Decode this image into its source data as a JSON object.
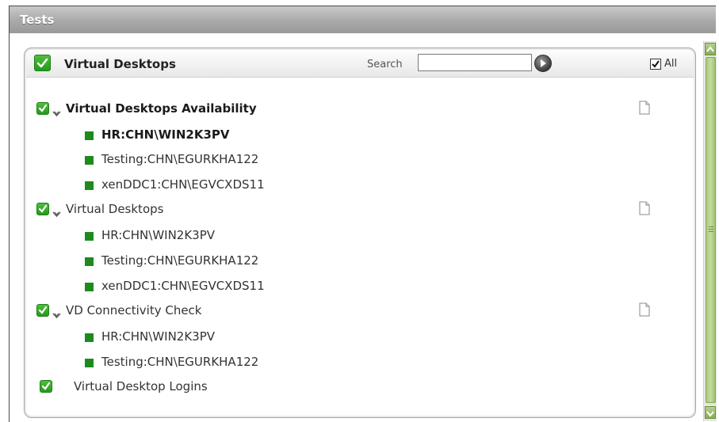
{
  "tests_section": {
    "title": "Tests"
  },
  "panel": {
    "title": "Virtual Desktops",
    "search_label": "Search",
    "search_value": "",
    "all_label": "All",
    "all_checked": true
  },
  "tests": [
    {
      "name": "Virtual Desktops Availability",
      "selected": true,
      "items": [
        "HR:CHN\\WIN2K3PV",
        "Testing:CHN\\EGURKHA122",
        "xenDDC1:CHN\\EGVCXDS11"
      ]
    },
    {
      "name": "Virtual Desktops",
      "selected": false,
      "items": [
        "HR:CHN\\WIN2K3PV",
        "Testing:CHN\\EGURKHA122",
        "xenDDC1:CHN\\EGVCXDS11"
      ]
    },
    {
      "name": "VD Connectivity Check",
      "selected": false,
      "items": [
        "HR:CHN\\WIN2K3PV",
        "Testing:CHN\\EGURKHA122"
      ]
    },
    {
      "name": "Virtual Desktop Logins",
      "selected": false,
      "items": []
    }
  ],
  "colors": {
    "check_green": "#2aa022",
    "leaf_green": "#1e8a1e",
    "header_gray": "#a9a9a9",
    "scrollbar_green": "#a9c97f"
  },
  "icons": {
    "checkbox": "green-check-icon",
    "expand": "chevron-down-icon",
    "report": "document-icon",
    "go": "go-arrow-icon"
  }
}
